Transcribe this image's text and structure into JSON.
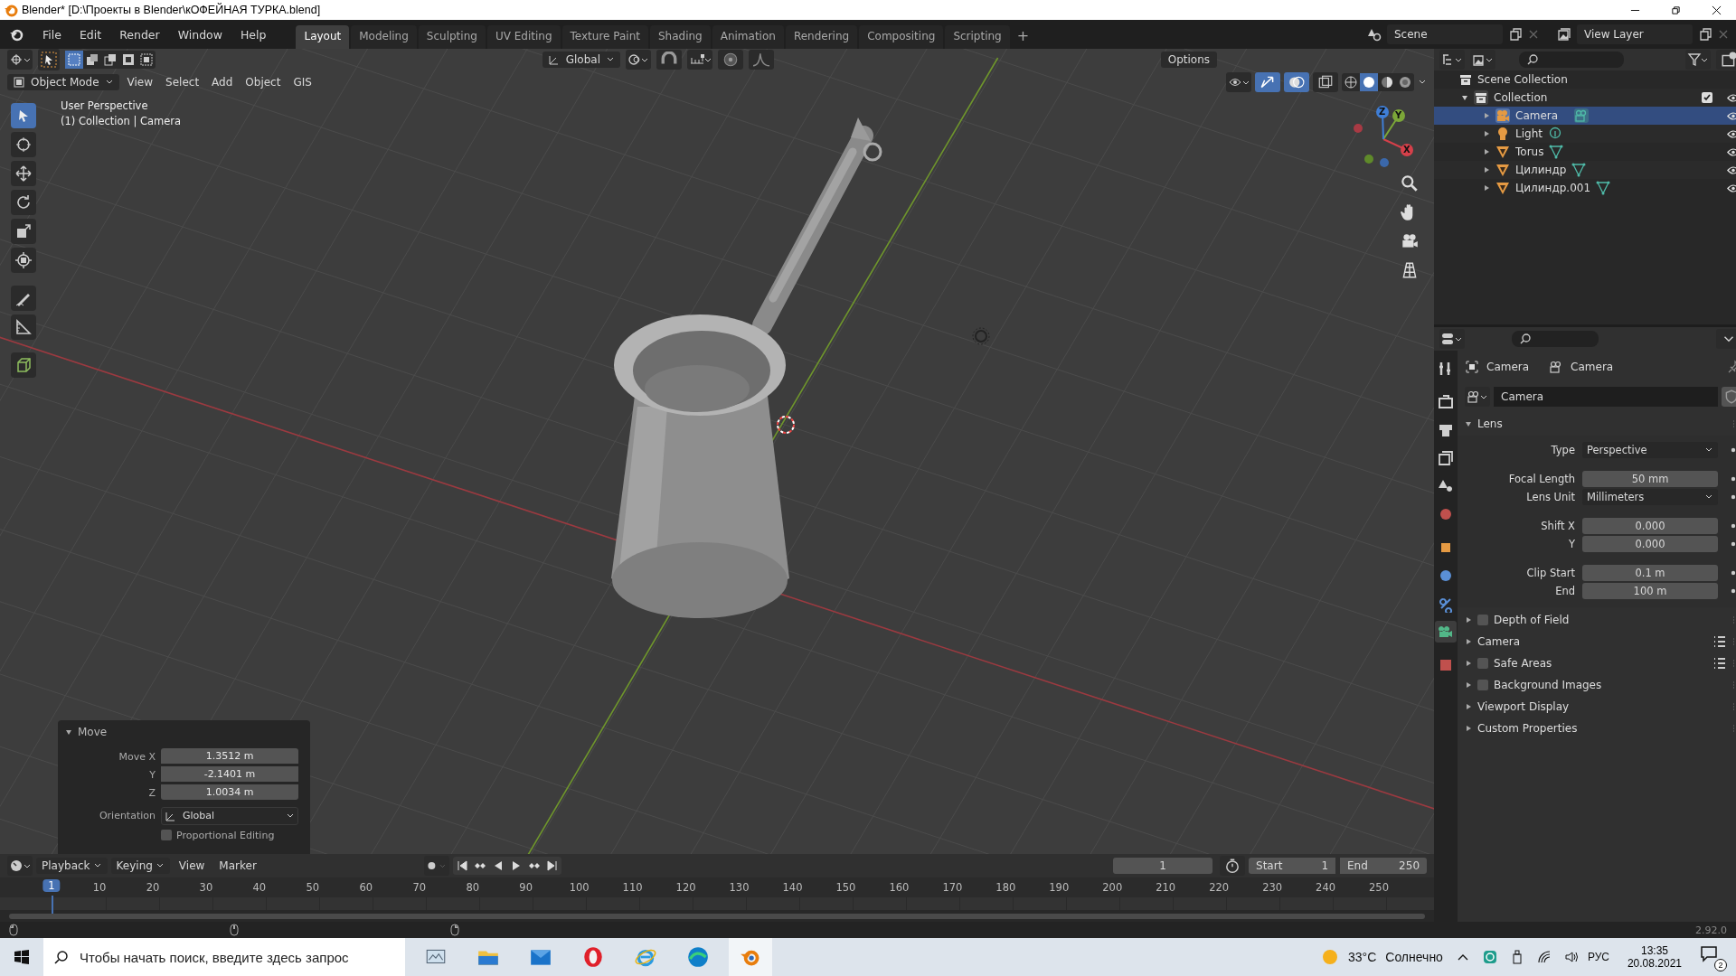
{
  "window": {
    "title": "Blender* [D:\\Проекты в Blender\\кОФЕЙНАЯ ТУРКА.blend]"
  },
  "menu": [
    "File",
    "Edit",
    "Render",
    "Window",
    "Help"
  ],
  "workspaces": [
    {
      "label": "Layout",
      "selected": true
    },
    {
      "label": "Modeling",
      "selected": false
    },
    {
      "label": "Sculpting",
      "selected": false
    },
    {
      "label": "UV Editing",
      "selected": false
    },
    {
      "label": "Texture Paint",
      "selected": false
    },
    {
      "label": "Shading",
      "selected": false
    },
    {
      "label": "Animation",
      "selected": false
    },
    {
      "label": "Rendering",
      "selected": false
    },
    {
      "label": "Compositing",
      "selected": false
    },
    {
      "label": "Scripting",
      "selected": false
    }
  ],
  "add_workspace": "+",
  "scene": "Scene",
  "view_layer": "View Layer",
  "viewport": {
    "orientation": "Global",
    "options": "Options",
    "mode": "Object Mode",
    "menus": [
      "View",
      "Select",
      "Add",
      "Object",
      "GIS"
    ],
    "perspective": "User Perspective",
    "context": "(1) Collection | Camera",
    "gizmo_axes": [
      "X",
      "Y",
      "Z"
    ]
  },
  "operator_panel": {
    "title": "Move",
    "expanded": true,
    "fields": [
      {
        "label": "Move X",
        "value": "1.3512 m"
      },
      {
        "label": "Y",
        "value": "-2.1401 m"
      },
      {
        "label": "Z",
        "value": "1.0034 m"
      }
    ],
    "orientation_label": "Orientation",
    "orientation": "Global",
    "proportional": {
      "label": "Proportional Editing",
      "checked": false
    }
  },
  "outliner": {
    "root": "Scene Collection",
    "collection": {
      "label": "Collection",
      "expanded": true,
      "checked": true
    },
    "items": [
      {
        "label": "Camera",
        "kind": "camera",
        "selected": true
      },
      {
        "label": "Light",
        "kind": "light",
        "selected": false
      },
      {
        "label": "Torus",
        "kind": "mesh",
        "selected": false
      },
      {
        "label": "Цилиндр",
        "kind": "mesh",
        "selected": false
      },
      {
        "label": "Цилиндр.001",
        "kind": "mesh",
        "selected": false
      }
    ]
  },
  "properties": {
    "tabs": [
      {
        "kind": "tool",
        "selected": false
      },
      {
        "kind": "render",
        "selected": false
      },
      {
        "kind": "output",
        "selected": false
      },
      {
        "kind": "view_layer",
        "selected": false
      },
      {
        "kind": "scene",
        "selected": false
      },
      {
        "kind": "world",
        "selected": false
      },
      {
        "kind": "object",
        "selected": false
      },
      {
        "kind": "physics",
        "selected": false
      },
      {
        "kind": "constraints",
        "selected": false
      },
      {
        "kind": "camera_data",
        "selected": true
      },
      {
        "kind": "texture",
        "selected": false
      }
    ],
    "breadcrumb": [
      "Camera",
      "Camera"
    ],
    "datablock": "Camera",
    "lens": {
      "title": "Lens",
      "expanded": true,
      "rows": [
        {
          "label": "Type",
          "value": "Perspective",
          "kind": "dropdown",
          "group_start": true
        },
        {
          "label": "Focal Length",
          "value": "50 mm",
          "kind": "number",
          "group_start": true
        },
        {
          "label": "Lens Unit",
          "value": "Millimeters",
          "kind": "dropdown",
          "group_start": false
        },
        {
          "label": "Shift X",
          "value": "0.000",
          "kind": "number",
          "group_start": true
        },
        {
          "label": "Y",
          "value": "0.000",
          "kind": "number",
          "group_start": false
        },
        {
          "label": "Clip Start",
          "value": "0.1 m",
          "kind": "number",
          "group_start": true
        },
        {
          "label": "End",
          "value": "100 m",
          "kind": "number",
          "group_start": false
        }
      ]
    },
    "panels": [
      {
        "label": "Depth of Field",
        "kind": "checkbox",
        "checked": false,
        "presets": false
      },
      {
        "label": "Camera",
        "kind": "plain",
        "presets": true
      },
      {
        "label": "Safe Areas",
        "kind": "checkbox",
        "checked": false,
        "presets": true
      },
      {
        "label": "Background Images",
        "kind": "checkbox",
        "checked": false,
        "presets": false
      },
      {
        "label": "Viewport Display",
        "kind": "plain",
        "presets": false
      },
      {
        "label": "Custom Properties",
        "kind": "plain",
        "presets": false
      }
    ]
  },
  "timeline": {
    "menus": [
      "Playback",
      "Keying",
      "View",
      "Marker"
    ],
    "current_frame": "1",
    "start_label": "Start",
    "start": "1",
    "end_label": "End",
    "end": "250",
    "ticks": [
      "1",
      "10",
      "20",
      "30",
      "40",
      "50",
      "60",
      "70",
      "80",
      "90",
      "100",
      "110",
      "120",
      "130",
      "140",
      "150",
      "160",
      "170",
      "180",
      "190",
      "200",
      "210",
      "220",
      "230",
      "240",
      "250"
    ]
  },
  "status_bar": {
    "version": "2.92.0"
  },
  "taskbar": {
    "search_placeholder": "Чтобы начать поиск, введите здесь запрос",
    "temperature": "33°C",
    "weather": "Солнечно",
    "language": "РУС",
    "time": "13:35",
    "date": "20.08.2021",
    "notifications": "2"
  }
}
